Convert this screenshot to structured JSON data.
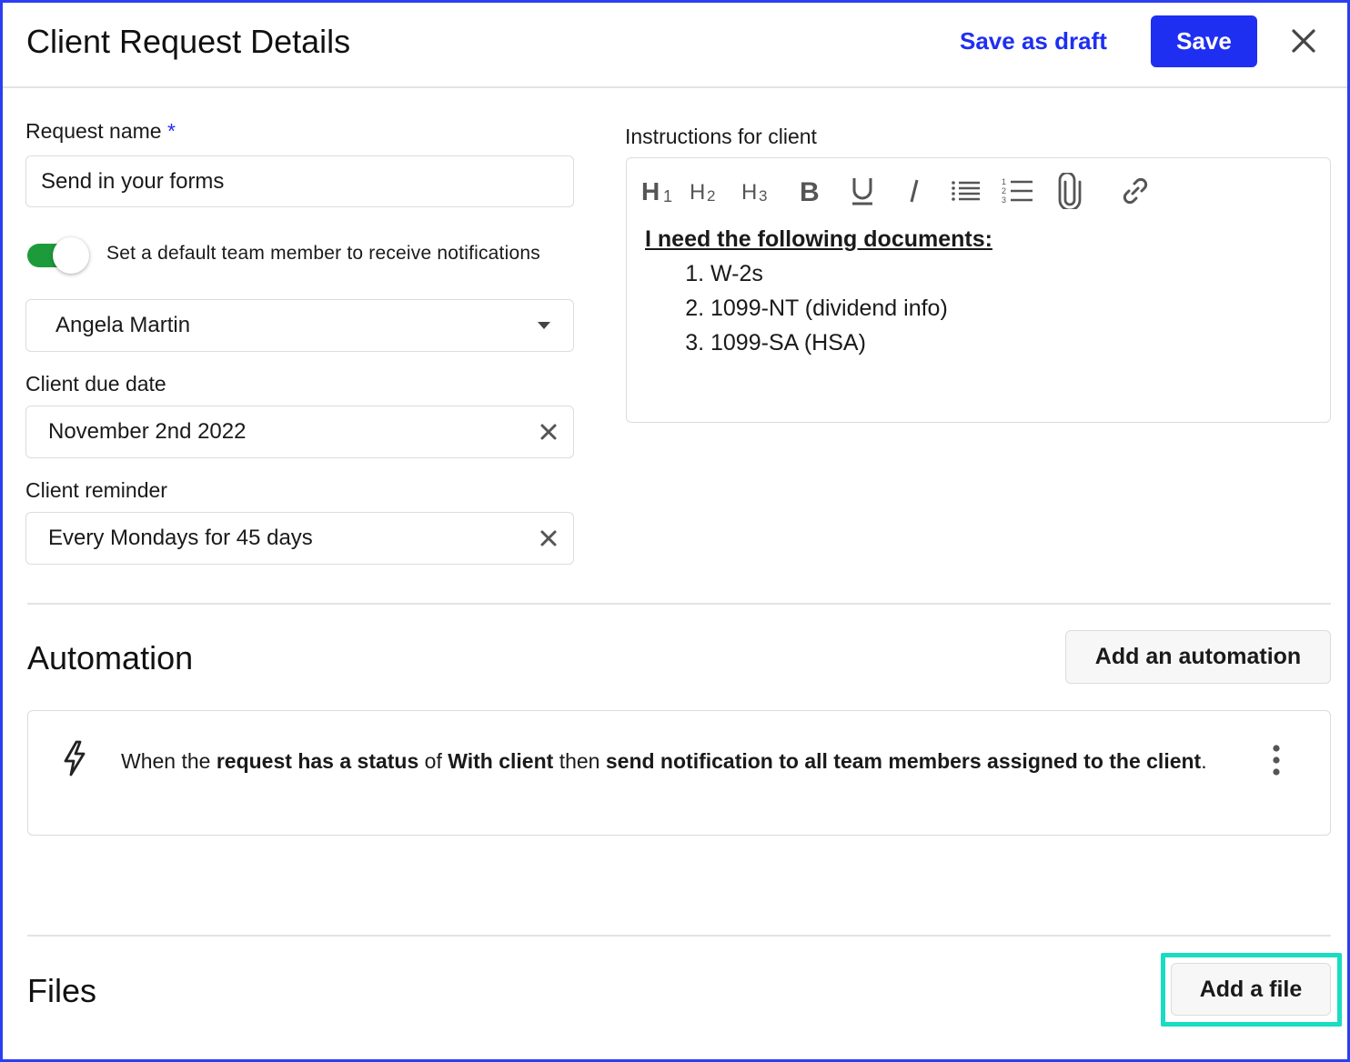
{
  "header": {
    "title": "Client Request Details",
    "save_draft_label": "Save as draft",
    "save_label": "Save",
    "close_icon": "close-icon"
  },
  "form": {
    "request_name_label": "Request name",
    "required_marker": "*",
    "request_name_value": "Send in your forms",
    "toggle_on": true,
    "toggle_label": "Set a default team member to receive notifications",
    "team_member_value": "Angela Martin",
    "due_date_label": "Client due date",
    "due_date_value": "November 2nd 2022",
    "reminder_label": "Client reminder",
    "reminder_value": "Every Mondays for 45 days"
  },
  "instructions": {
    "label": "Instructions for client",
    "toolbar": [
      "H1",
      "H2",
      "H3",
      "bold",
      "underline",
      "italic",
      "bulleted-list",
      "numbered-list",
      "attachment",
      "link"
    ],
    "heading": "I need the following documents:",
    "items": [
      "W-2s",
      "1099-NT (dividend info)",
      "1099-SA (HSA)"
    ]
  },
  "automation": {
    "title": "Automation",
    "add_label": "Add an automation",
    "rule": {
      "t1": "When the ",
      "b1": "request has a status",
      "t2": " of ",
      "b2": "With client",
      "t3": " then ",
      "b3": "send notification to all team members assigned to the client",
      "t4": "."
    }
  },
  "files": {
    "title": "Files",
    "add_label": "Add a file"
  },
  "colors": {
    "primary": "#1f2ff2",
    "toggle_on": "#1d9b3a",
    "highlight": "#19dcc0"
  }
}
